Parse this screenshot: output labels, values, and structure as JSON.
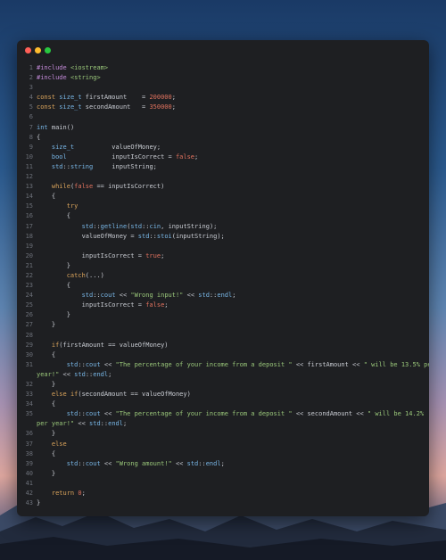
{
  "window": {
    "controls": [
      "close",
      "minimize",
      "maximize"
    ]
  },
  "code": {
    "lines": [
      {
        "n": "1",
        "text": "#include <iostream>"
      },
      {
        "n": "2",
        "text": "#include <string>"
      },
      {
        "n": "3",
        "text": ""
      },
      {
        "n": "4",
        "text": "const size_t firstAmount    = 200000;"
      },
      {
        "n": "5",
        "text": "const size_t secondAmount   = 350000;"
      },
      {
        "n": "6",
        "text": ""
      },
      {
        "n": "7",
        "text": "int main()"
      },
      {
        "n": "8",
        "text": "{"
      },
      {
        "n": "9",
        "text": "    size_t          valueOfMoney;"
      },
      {
        "n": "10",
        "text": "    bool            inputIsCorrect = false;"
      },
      {
        "n": "11",
        "text": "    std::string     inputString;"
      },
      {
        "n": "12",
        "text": ""
      },
      {
        "n": "13",
        "text": "    while(false == inputIsCorrect)"
      },
      {
        "n": "14",
        "text": "    {"
      },
      {
        "n": "15",
        "text": "        try"
      },
      {
        "n": "16",
        "text": "        {"
      },
      {
        "n": "17",
        "text": "            std::getline(std::cin, inputString);"
      },
      {
        "n": "18",
        "text": "            valueOfMoney = std::stoi(inputString);"
      },
      {
        "n": "19",
        "text": ""
      },
      {
        "n": "20",
        "text": "            inputIsCorrect = true;"
      },
      {
        "n": "21",
        "text": "        }"
      },
      {
        "n": "22",
        "text": "        catch(...)"
      },
      {
        "n": "23",
        "text": "        {"
      },
      {
        "n": "24",
        "text": "            std::cout << \"Wrong input!\" << std::endl;"
      },
      {
        "n": "25",
        "text": "            inputIsCorrect = false;"
      },
      {
        "n": "26",
        "text": "        }"
      },
      {
        "n": "27",
        "text": "    }"
      },
      {
        "n": "28",
        "text": ""
      },
      {
        "n": "29",
        "text": "    if(firstAmount == valueOfMoney)"
      },
      {
        "n": "30",
        "text": "    {"
      },
      {
        "n": "31",
        "text": "        std::cout << \"The percentage of your income from a deposit \" << firstAmount << \" will be 13.5% per",
        "wrap": "year!\" << std::endl;"
      },
      {
        "n": "32",
        "text": "    }"
      },
      {
        "n": "33",
        "text": "    else if(secondAmount == valueOfMoney)"
      },
      {
        "n": "34",
        "text": "    {"
      },
      {
        "n": "35",
        "text": "        std::cout << \"The percentage of your income from a deposit \" << secondAmount << \" will be 14.2%",
        "wrap": "per year!\" << std::endl;"
      },
      {
        "n": "36",
        "text": "    }"
      },
      {
        "n": "37",
        "text": "    else"
      },
      {
        "n": "38",
        "text": "    {"
      },
      {
        "n": "39",
        "text": "        std::cout << \"Wrong amount!\" << std::endl;"
      },
      {
        "n": "40",
        "text": "    }"
      },
      {
        "n": "41",
        "text": ""
      },
      {
        "n": "42",
        "text": "    return 0;"
      },
      {
        "n": "43",
        "text": "}"
      }
    ]
  },
  "colors": {
    "editor_bg": "#1e1f22",
    "text": "#c9ccd3",
    "keyword": "#d9a35b",
    "type": "#78b6e6",
    "string": "#9ac77a",
    "number": "#e0725e",
    "line_number": "#6b6f78"
  }
}
